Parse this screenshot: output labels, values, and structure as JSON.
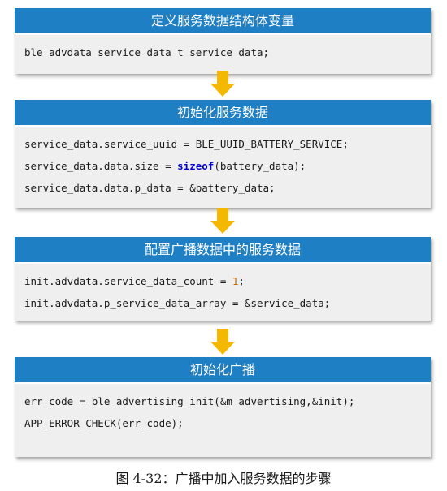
{
  "colors": {
    "header_bg": "#1f7fc4",
    "body_bg": "#efefef",
    "arrow": "#f5b800",
    "keyword": "#0000cc",
    "number": "#cc6600"
  },
  "steps": [
    {
      "title": "定义服务数据结构体变量",
      "lines": [
        [
          {
            "t": "ble_advdata_service_data_t service_data;"
          }
        ]
      ]
    },
    {
      "title": "初始化服务数据",
      "lines": [
        [
          {
            "t": "service_data.service_uuid = BLE_UUID_BATTERY_SERVICE;"
          }
        ],
        [
          {
            "t": "service_data.data.size = "
          },
          {
            "t": "sizeof",
            "c": "kw"
          },
          {
            "t": "(battery_data);"
          }
        ],
        [
          {
            "t": "service_data.data.p_data = &battery_data;"
          }
        ]
      ]
    },
    {
      "title": "配置广播数据中的服务数据",
      "lines": [
        [
          {
            "t": "init.advdata.service_data_count = "
          },
          {
            "t": "1",
            "c": "num"
          },
          {
            "t": ";"
          }
        ],
        [
          {
            "t": "init.advdata.p_service_data_array = &service_data;"
          }
        ]
      ]
    },
    {
      "title": "初始化广播",
      "lines": [
        [
          {
            "t": "err_code = ble_advertising_init(&m_advertising,&init);"
          }
        ],
        [
          {
            "t": "APP_ERROR_CHECK(err_code);"
          }
        ]
      ]
    }
  ],
  "caption": "图 4-32：广播中加入服务数据的步骤"
}
